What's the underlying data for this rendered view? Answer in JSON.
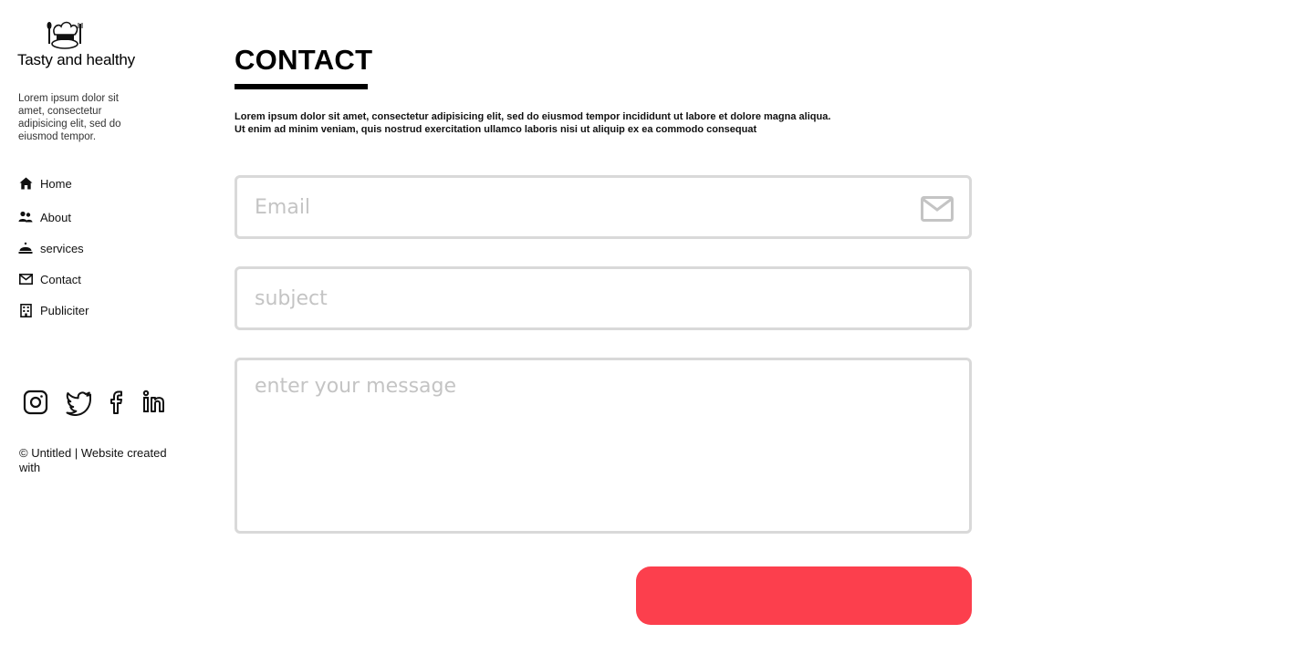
{
  "brand": {
    "name": "Tasty and healthy",
    "tagline": "Lorem ipsum dolor sit amet, consectetur adipisicing elit, sed do eiusmod tempor.",
    "logo_icon": "chef-hat-cutlery-icon"
  },
  "nav": {
    "items": [
      {
        "label": "Home",
        "icon": "home-icon"
      },
      {
        "label": "About",
        "icon": "users-icon"
      },
      {
        "label": "services",
        "icon": "service-bell-icon"
      },
      {
        "label": "Contact",
        "icon": "envelope-icon"
      },
      {
        "label": "Publiciter",
        "icon": "building-icon"
      }
    ]
  },
  "socials": [
    "instagram-icon",
    "twitter-icon",
    "facebook-icon",
    "linkedin-icon"
  ],
  "footer": {
    "text": "© Untitled | Website created with"
  },
  "contact": {
    "title": "CONTACT",
    "intro_line1": "Lorem ipsum dolor sit amet, consectetur adipisicing elit, sed do eiusmod tempor incididunt ut labore et dolore magna aliqua.",
    "intro_line2": "Ut enim ad minim veniam, quis nostrud exercitation ullamco laboris nisi ut aliquip ex ea commodo consequat",
    "email_placeholder": "Email",
    "email_value": "",
    "subject_placeholder": "subject",
    "subject_value": "",
    "message_placeholder": "enter your message",
    "message_value": "",
    "send_label": ""
  },
  "colors": {
    "accent": "#fc3f4d",
    "field_border": "#d9d9d9",
    "placeholder": "#c4c4c4",
    "text": "#000000"
  }
}
